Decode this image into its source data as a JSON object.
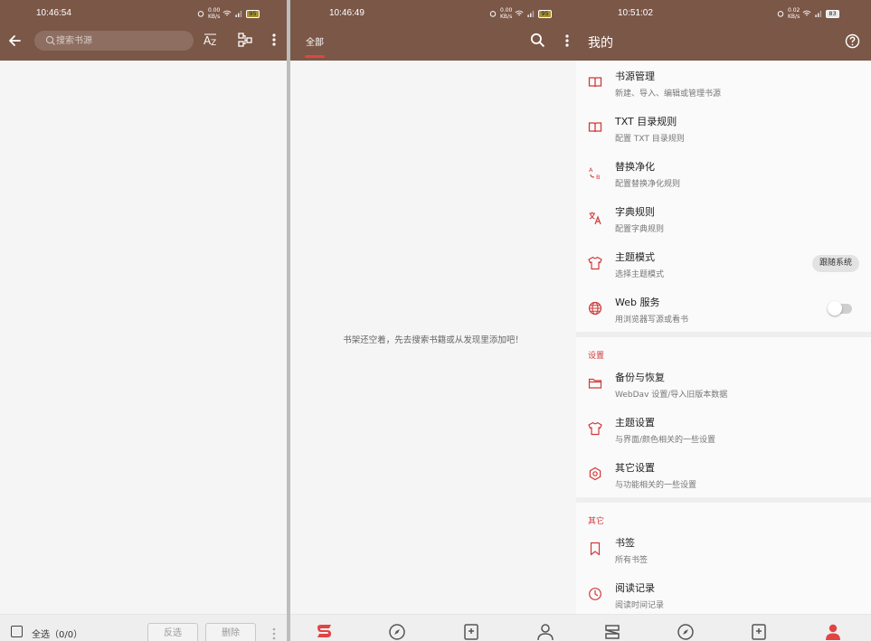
{
  "colors": {
    "toolbar": "#7b5747",
    "accent": "#e24444"
  },
  "panel1": {
    "status_time": "10:46:54",
    "status_net": "0.00\nKB/s",
    "battery": "95",
    "search_placeholder": "搜索书源",
    "select_all_label": "全选（0/0）",
    "invert_label": "反选",
    "delete_label": "删除",
    "icons": [
      "back-arrow-icon",
      "search-icon",
      "sort-az-icon",
      "group-icon",
      "more-vert-icon"
    ]
  },
  "panel2": {
    "status_time": "10:46:49",
    "status_net": "0.00\nKB/s",
    "battery": "95",
    "tab_all": "全部",
    "empty_message": "书架还空着，先去搜索书籍或从发现里添加吧！",
    "nav": [
      "bookshelf-icon",
      "explore-icon",
      "rss-icon",
      "my-icon"
    ]
  },
  "panel3": {
    "status_time": "10:51:02",
    "status_net": "0.02\nKB/s",
    "battery": "83",
    "title": "我的",
    "items": [
      {
        "title": "书源管理",
        "sub": "新建、导入、编辑或管理书源",
        "icon": "book-source-icon"
      },
      {
        "title": "TXT 目录规则",
        "sub": "配置 TXT 目录规则",
        "icon": "txt-rule-icon"
      },
      {
        "title": "替换净化",
        "sub": "配置替换净化规则",
        "icon": "replace-icon"
      },
      {
        "title": "字典规则",
        "sub": "配置字典规则",
        "icon": "dictionary-icon"
      },
      {
        "title": "主题模式",
        "sub": "选择主题模式",
        "icon": "theme-mode-icon",
        "chip": "跟随系统"
      },
      {
        "title": "Web 服务",
        "sub": "用浏览器写源或看书",
        "icon": "web-icon",
        "toggle": false
      }
    ],
    "section_settings": "设置",
    "settings_items": [
      {
        "title": "备份与恢复",
        "sub": "WebDav 设置/导入旧版本数据",
        "icon": "folder-icon"
      },
      {
        "title": "主题设置",
        "sub": "与界面/颜色相关的一些设置",
        "icon": "shirt-icon"
      },
      {
        "title": "其它设置",
        "sub": "与功能相关的一些设置",
        "icon": "settings-gear-icon"
      }
    ],
    "section_other": "其它",
    "other_items": [
      {
        "title": "书签",
        "sub": "所有书签",
        "icon": "bookmark-icon"
      },
      {
        "title": "阅读记录",
        "sub": "阅读时间记录",
        "icon": "history-icon"
      }
    ]
  }
}
